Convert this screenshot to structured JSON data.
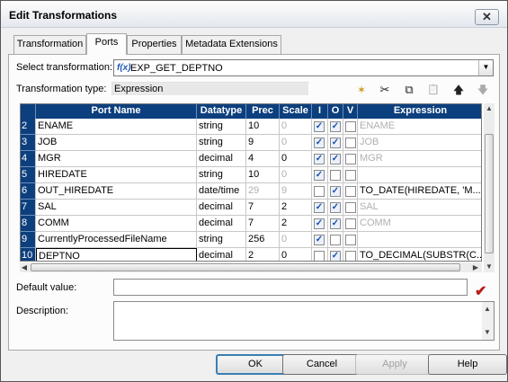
{
  "window": {
    "title": "Edit Transformations",
    "close_label": "✕"
  },
  "tabs": [
    {
      "label": "Transformation",
      "active": false
    },
    {
      "label": "Ports",
      "active": true
    },
    {
      "label": "Properties",
      "active": false
    },
    {
      "label": "Metadata Extensions",
      "active": false
    }
  ],
  "select_transformation": {
    "label": "Select transformation:",
    "value": "EXP_GET_DEPTNO",
    "icon": "f(x)"
  },
  "transformation_type": {
    "label": "Transformation type:",
    "value": "Expression"
  },
  "toolbar": {
    "new_port_icon": "✶",
    "cut_icon": "✂",
    "copy_icon": "⧉",
    "paste_icon": "📋",
    "move_up_icon": "🡅",
    "move_down_icon": "🡇"
  },
  "grid": {
    "columns": [
      "Port Name",
      "Datatype",
      "Prec",
      "Scale",
      "I",
      "O",
      "V",
      "Expression"
    ],
    "rows": [
      {
        "num": "2",
        "name": "ENAME",
        "datatype": "string",
        "prec": "10",
        "scale": "0",
        "i": true,
        "o": true,
        "v": false,
        "expression": "ENAME",
        "expr_grey": true,
        "scale_grey": true,
        "prec_grey": false
      },
      {
        "num": "3",
        "name": "JOB",
        "datatype": "string",
        "prec": "9",
        "scale": "0",
        "i": true,
        "o": true,
        "v": false,
        "expression": "JOB",
        "expr_grey": true,
        "scale_grey": true,
        "prec_grey": false
      },
      {
        "num": "4",
        "name": "MGR",
        "datatype": "decimal",
        "prec": "4",
        "scale": "0",
        "i": true,
        "o": true,
        "v": false,
        "expression": "MGR",
        "expr_grey": true,
        "scale_grey": false,
        "prec_grey": false
      },
      {
        "num": "5",
        "name": "HIREDATE",
        "datatype": "string",
        "prec": "10",
        "scale": "0",
        "i": true,
        "o": false,
        "v": false,
        "expression": "",
        "expr_grey": false,
        "scale_grey": true,
        "prec_grey": false
      },
      {
        "num": "6",
        "name": "OUT_HIREDATE",
        "datatype": "date/time",
        "prec": "29",
        "scale": "9",
        "i": false,
        "o": true,
        "v": false,
        "expression": "TO_DATE(HIREDATE, 'M...",
        "expr_grey": false,
        "scale_grey": true,
        "prec_grey": true
      },
      {
        "num": "7",
        "name": "SAL",
        "datatype": "decimal",
        "prec": "7",
        "scale": "2",
        "i": true,
        "o": true,
        "v": false,
        "expression": "SAL",
        "expr_grey": true,
        "scale_grey": false,
        "prec_grey": false
      },
      {
        "num": "8",
        "name": "COMM",
        "datatype": "decimal",
        "prec": "7",
        "scale": "2",
        "i": true,
        "o": true,
        "v": false,
        "expression": "COMM",
        "expr_grey": true,
        "scale_grey": false,
        "prec_grey": false
      },
      {
        "num": "9",
        "name": "CurrentlyProcessedFileName",
        "datatype": "string",
        "prec": "256",
        "scale": "0",
        "i": true,
        "o": false,
        "v": false,
        "expression": "",
        "expr_grey": false,
        "scale_grey": true,
        "prec_grey": false
      },
      {
        "num": "10",
        "name": "DEPTNO",
        "datatype": "decimal",
        "prec": "2",
        "scale": "0",
        "i": false,
        "o": true,
        "v": false,
        "expression": "TO_DECIMAL(SUBSTR(C...",
        "expr_grey": false,
        "scale_grey": false,
        "prec_grey": false
      }
    ]
  },
  "default_value": {
    "label": "Default value:",
    "value": ""
  },
  "description": {
    "label": "Description:",
    "value": ""
  },
  "buttons": {
    "ok": "OK",
    "cancel": "Cancel",
    "apply": "Apply",
    "help": "Help"
  },
  "colors": {
    "header_bg": "#0c3f7e",
    "validate_check": "#b71c1c"
  }
}
